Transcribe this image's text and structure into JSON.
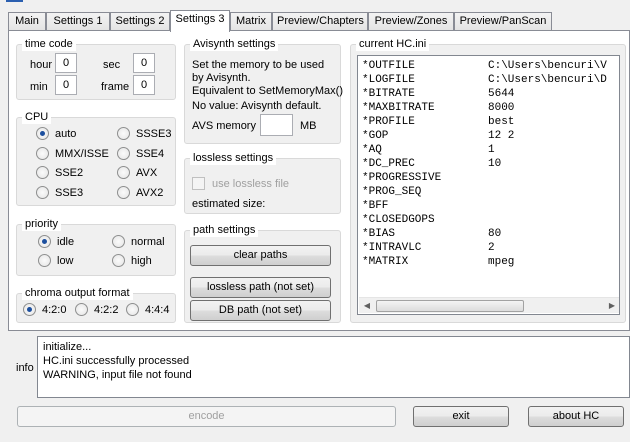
{
  "tabs": [
    {
      "label": "Main"
    },
    {
      "label": "Settings 1"
    },
    {
      "label": "Settings 2"
    },
    {
      "label": "Settings 3"
    },
    {
      "label": "Matrix"
    },
    {
      "label": "Preview/Chapters"
    },
    {
      "label": "Preview/Zones"
    },
    {
      "label": "Preview/PanScan"
    }
  ],
  "active_tab": "Settings 3",
  "timecode": {
    "title": "time code",
    "hour_label": "hour",
    "hour_value": "0",
    "sec_label": "sec",
    "sec_value": "0",
    "min_label": "min",
    "min_value": "0",
    "frame_label": "frame",
    "frame_value": "0"
  },
  "cpu": {
    "title": "CPU",
    "options": [
      {
        "label": "auto",
        "selected": true
      },
      {
        "label": "SSSE3",
        "selected": false
      },
      {
        "label": "MMX/ISSE",
        "selected": false
      },
      {
        "label": "SSE4",
        "selected": false
      },
      {
        "label": "SSE2",
        "selected": false
      },
      {
        "label": "AVX",
        "selected": false
      },
      {
        "label": "SSE3",
        "selected": false
      },
      {
        "label": "AVX2",
        "selected": false
      }
    ]
  },
  "priority": {
    "title": "priority",
    "options": [
      {
        "label": "idle",
        "selected": true
      },
      {
        "label": "normal",
        "selected": false
      },
      {
        "label": "low",
        "selected": false
      },
      {
        "label": "high",
        "selected": false
      }
    ]
  },
  "chroma": {
    "title": "chroma output format",
    "options": [
      {
        "label": "4:2:0",
        "selected": true
      },
      {
        "label": "4:2:2",
        "selected": false
      },
      {
        "label": "4:4:4",
        "selected": false
      }
    ]
  },
  "avisynth": {
    "title": "Avisynth settings",
    "line1": "Set the memory to be used",
    "line2": "by Avisynth.",
    "line3": "Equivalent to SetMemoryMax()",
    "line4": "No value: Avisynth default.",
    "memory_label": "AVS memory",
    "memory_value": "",
    "memory_unit": "MB"
  },
  "lossless": {
    "title": "lossless settings",
    "checkbox_label": "use lossless file",
    "checked": false,
    "estimated_label": "estimated size:"
  },
  "path": {
    "title": "path settings",
    "clear_button": "clear paths",
    "lossless_button": "lossless path (not set)",
    "db_button": "DB path (not set)"
  },
  "ini": {
    "title": "current HC.ini",
    "rows": [
      {
        "key": "*OUTFILE",
        "value": "C:\\Users\\bencuri\\V"
      },
      {
        "key": "*LOGFILE",
        "value": "C:\\Users\\bencuri\\D"
      },
      {
        "key": "*BITRATE",
        "value": "5644"
      },
      {
        "key": "*MAXBITRATE",
        "value": "8000"
      },
      {
        "key": "*PROFILE",
        "value": "best"
      },
      {
        "key": "*GOP",
        "value": "12 2"
      },
      {
        "key": "*AQ",
        "value": "1"
      },
      {
        "key": "*DC_PREC",
        "value": "10"
      },
      {
        "key": "*PROGRESSIVE",
        "value": ""
      },
      {
        "key": "*PROG_SEQ",
        "value": ""
      },
      {
        "key": "*BFF",
        "value": ""
      },
      {
        "key": "*CLOSEDGOPS",
        "value": ""
      },
      {
        "key": "*BIAS",
        "value": "80"
      },
      {
        "key": "*INTRAVLC",
        "value": "2"
      },
      {
        "key": "*MATRIX",
        "value": "mpeg"
      }
    ]
  },
  "info": {
    "label": "info",
    "lines": [
      "initialize...",
      "HC.ini successfully processed",
      "WARNING, input file not found"
    ]
  },
  "buttons": {
    "encode": "encode",
    "exit": "exit",
    "about": "about HC"
  },
  "colors": {
    "accent": "#1c4f9e",
    "title_accent": "#2b5fb0"
  }
}
